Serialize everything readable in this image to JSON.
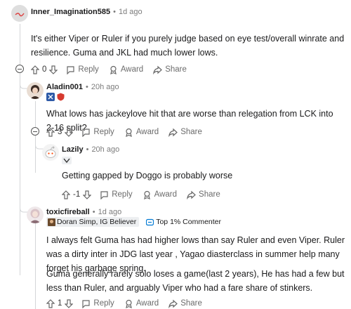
{
  "comments": [
    {
      "username": "Inner_Imagination585",
      "time": "1d ago",
      "body": "It's either Viper or Ruler if you purely judge based on eye test/overall winrate and resilience. Guma and JKL had much lower lows.",
      "vote_count": "0",
      "actions": {
        "reply": "Reply",
        "award": "Award",
        "share": "Share"
      }
    },
    {
      "username": "Aladin001",
      "time": "20h ago",
      "body": "What lows has jackeylove hit that are worse than relegation from LCK into 2-16 split?",
      "vote_count": "3",
      "actions": {
        "reply": "Reply",
        "award": "Award",
        "share": "Share"
      }
    },
    {
      "username": "Lazily",
      "time": "20h ago",
      "body": "Getting gapped by Doggo is probably worse",
      "vote_count": "-1",
      "actions": {
        "reply": "Reply",
        "award": "Award",
        "share": "Share"
      }
    },
    {
      "username": "toxicfireball",
      "time": "1d ago",
      "flair": "Doran Simp, IG Believer",
      "badge": "Top 1% Commenter",
      "body_p1": "I always felt Guma has had higher lows than say Ruler and even Viper. Ruler was a dirty inter in JDG last year , Yagao diasterclass in summer help many forget his garbage spring.",
      "body_p2": "Guma generally rarely solo loses a game(last 2 years), He has had a few but less than Ruler, and arguably Viper who had a fare share of stinkers.",
      "vote_count": "1",
      "actions": {
        "reply": "Reply",
        "award": "Award",
        "share": "Share"
      }
    }
  ],
  "colors": {
    "thread": "#d4d6d8",
    "meta": "#7c7c7c",
    "action": "#6b6b6b",
    "badge_blue": "#0079d3"
  },
  "icons": [
    "upvote-icon",
    "downvote-icon",
    "reply-icon",
    "award-icon",
    "share-icon",
    "collapse-icon"
  ]
}
